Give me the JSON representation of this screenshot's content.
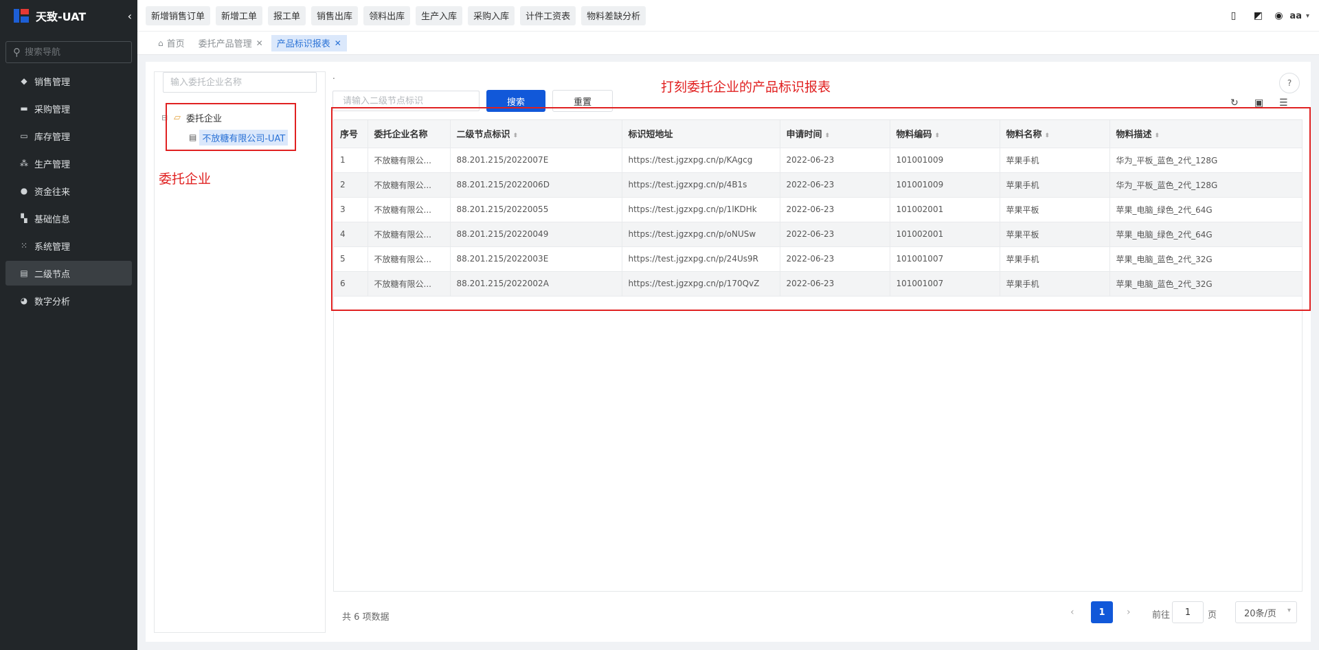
{
  "app": {
    "title": "天致-UAT"
  },
  "sidebar": {
    "search_placeholder": "搜索导航",
    "items": [
      {
        "label": "销售管理",
        "icon": "tag-icon"
      },
      {
        "label": "采购管理",
        "icon": "cart-icon"
      },
      {
        "label": "库存管理",
        "icon": "warehouse-icon"
      },
      {
        "label": "生产管理",
        "icon": "factory-icon"
      },
      {
        "label": "资金往来",
        "icon": "money-icon"
      },
      {
        "label": "基础信息",
        "icon": "grid-icon"
      },
      {
        "label": "系统管理",
        "icon": "apps-icon"
      },
      {
        "label": "二级节点",
        "icon": "document-icon",
        "active": true
      },
      {
        "label": "数字分析",
        "icon": "pie-chart-icon"
      }
    ]
  },
  "quick_actions": [
    "新增销售订单",
    "新增工单",
    "报工单",
    "销售出库",
    "领料出库",
    "生产入库",
    "采购入库",
    "计件工资表",
    "物料差缺分析"
  ],
  "user": {
    "name": "aa"
  },
  "tabs": [
    {
      "label": "首页"
    },
    {
      "label": "委托产品管理"
    },
    {
      "label": "产品标识报表"
    }
  ],
  "tree": {
    "search_placeholder": "输入委托企业名称",
    "root_label": "委托企业",
    "child_label": "不放糖有限公司-UAT"
  },
  "annotations": {
    "tree_note": "委托企业",
    "table_note": "打刻委托企业的产品标识报表"
  },
  "toolbar": {
    "dot": ".",
    "search_placeholder": "请输入二级节点标识",
    "search_label": "搜索",
    "reset_label": "重置"
  },
  "table": {
    "columns": [
      "序号",
      "委托企业名称",
      "二级节点标识",
      "标识短地址",
      "申请时间",
      "物料编码",
      "物料名称",
      "物料描述"
    ],
    "rows": [
      [
        "1",
        "不放糖有限公...",
        "88.201.215/2022007E",
        "https://test.jgzxpg.cn/p/KAgcg",
        "2022-06-23",
        "101001009",
        "苹果手机",
        "华为_平板_蓝色_2代_128G"
      ],
      [
        "2",
        "不放糖有限公...",
        "88.201.215/2022006D",
        "https://test.jgzxpg.cn/p/4B1s",
        "2022-06-23",
        "101001009",
        "苹果手机",
        "华为_平板_蓝色_2代_128G"
      ],
      [
        "3",
        "不放糖有限公...",
        "88.201.215/20220055",
        "https://test.jgzxpg.cn/p/1lKDHk",
        "2022-06-23",
        "101002001",
        "苹果平板",
        "苹果_电脑_绿色_2代_64G"
      ],
      [
        "4",
        "不放糖有限公...",
        "88.201.215/20220049",
        "https://test.jgzxpg.cn/p/oNUSw",
        "2022-06-23",
        "101002001",
        "苹果平板",
        "苹果_电脑_绿色_2代_64G"
      ],
      [
        "5",
        "不放糖有限公...",
        "88.201.215/2022003E",
        "https://test.jgzxpg.cn/p/24Us9R",
        "2022-06-23",
        "101001007",
        "苹果手机",
        "苹果_电脑_蓝色_2代_32G"
      ],
      [
        "6",
        "不放糖有限公...",
        "88.201.215/2022002A",
        "https://test.jgzxpg.cn/p/170QvZ",
        "2022-06-23",
        "101001007",
        "苹果手机",
        "苹果_电脑_蓝色_2代_32G"
      ]
    ]
  },
  "pagination": {
    "total_text": "共 6 项数据",
    "current_page": "1",
    "goto_label": "前往",
    "goto_value": "1",
    "goto_unit": "页",
    "page_size": "20条/页"
  },
  "colors": {
    "primary": "#1158d9",
    "sidebar_bg": "#222629",
    "annotation": "#e02020"
  }
}
